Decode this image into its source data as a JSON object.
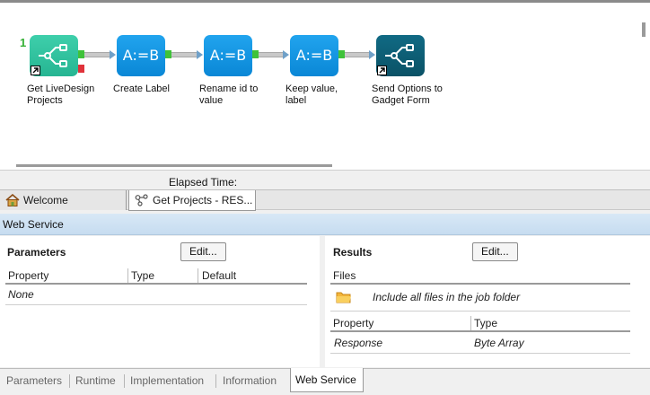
{
  "workflow": {
    "step_number": "1",
    "nodes": [
      {
        "label_line1": "Get LiveDesign",
        "label_line2": "Projects",
        "icon": "node-graph-icon"
      },
      {
        "label_line1": "Create Label",
        "label_line2": "",
        "text": "A:=B"
      },
      {
        "label_line1": "Rename id to",
        "label_line2": "value",
        "text": "A:=B"
      },
      {
        "label_line1": "Keep value,",
        "label_line2": "label",
        "text": "A:=B"
      },
      {
        "label_line1": "Send Options to",
        "label_line2": "Gadget Form",
        "icon": "node-graph-icon"
      }
    ]
  },
  "elapsed_label": "Elapsed Time:",
  "doc_tabs": [
    {
      "label": "Welcome",
      "icon": "home-icon"
    },
    {
      "label": "Get Projects - RES...",
      "icon": "workflow-icon"
    }
  ],
  "section_title": "Web Service",
  "parameters": {
    "title": "Parameters",
    "edit_label": "Edit...",
    "columns": [
      "Property",
      "Type",
      "Default"
    ],
    "rows": [
      {
        "property": "None"
      }
    ]
  },
  "results": {
    "title": "Results",
    "edit_label": "Edit...",
    "files_header": "Files",
    "files_row": "Include all files in the job folder",
    "columns": [
      "Property",
      "Type"
    ],
    "rows": [
      {
        "property": "Response",
        "type": "Byte Array"
      }
    ]
  },
  "bottom_tabs": [
    "Parameters",
    "Runtime",
    "Implementation",
    "Information",
    "Web Service"
  ],
  "colors": {
    "node_first": "#2fc39f",
    "node_blue": "#1597e4",
    "node_dark": "#0c5a70",
    "header_blue": "#cfe2f4"
  }
}
